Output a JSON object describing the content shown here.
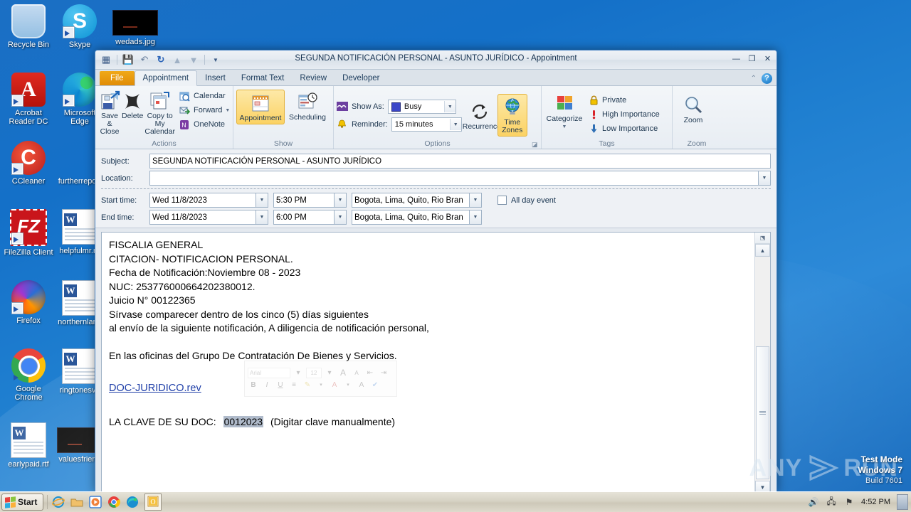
{
  "desktop": {
    "icons": [
      {
        "label": "Recycle Bin",
        "icon": "recycle-bin-icon",
        "shortcut": false
      },
      {
        "label": "Skype",
        "icon": "skype-icon",
        "shortcut": true
      },
      {
        "label": "wedads.jpg",
        "icon": "image-file-icon",
        "shortcut": false
      },
      {
        "label": "Acrobat Reader DC",
        "icon": "acrobat-reader-icon",
        "shortcut": true
      },
      {
        "label": "Microsoft Edge",
        "icon": "microsoft-edge-icon",
        "shortcut": true
      },
      {
        "label": "CCleaner",
        "icon": "ccleaner-icon",
        "shortcut": true
      },
      {
        "label": "furtherreport",
        "icon": "image-file-icon",
        "shortcut": false
      },
      {
        "label": "FileZilla Client",
        "icon": "filezilla-icon",
        "shortcut": true
      },
      {
        "label": "helpfulmr.rtf",
        "icon": "word-document-icon",
        "shortcut": false
      },
      {
        "label": "Firefox",
        "icon": "firefox-icon",
        "shortcut": true
      },
      {
        "label": "northernland",
        "icon": "word-document-icon",
        "shortcut": false
      },
      {
        "label": "Google Chrome",
        "icon": "google-chrome-icon",
        "shortcut": true
      },
      {
        "label": "ringtonesva",
        "icon": "word-document-icon",
        "shortcut": false
      },
      {
        "label": "earlypaid.rtf",
        "icon": "word-document-icon",
        "shortcut": false
      },
      {
        "label": "valuesfriend",
        "icon": "image-file-icon",
        "shortcut": false
      }
    ]
  },
  "window": {
    "title": "SEGUNDA NOTIFICACIÓN PERSONAL - ASUNTO JURÍDICO  -  Appointment",
    "quick_access": [
      "appointment-icon",
      "save-icon",
      "undo-icon",
      "redo-icon",
      "previous-item-icon",
      "next-item-icon",
      "customize-qat-icon"
    ],
    "controls": {
      "minimize": "—",
      "maximize": "❐",
      "close": "✕"
    }
  },
  "tabs": {
    "file": "File",
    "items": [
      {
        "label": "Appointment",
        "active": true
      },
      {
        "label": "Insert",
        "active": false
      },
      {
        "label": "Format Text",
        "active": false
      },
      {
        "label": "Review",
        "active": false
      },
      {
        "label": "Developer",
        "active": false
      }
    ]
  },
  "ribbon": {
    "groups": [
      {
        "name": "Actions",
        "big_buttons": [
          {
            "label": "Save & Close",
            "icon": "save-close-icon",
            "selected": false
          },
          {
            "label": "Delete",
            "icon": "delete-x-icon",
            "selected": false
          },
          {
            "label": "Copy to My Calendar",
            "icon": "copy-calendar-icon",
            "selected": false
          }
        ],
        "small_buttons": [
          {
            "label": "Calendar",
            "icon": "calendar-icon"
          },
          {
            "label": "Forward",
            "icon": "forward-icon",
            "has_arrow": true
          },
          {
            "label": "OneNote",
            "icon": "onenote-icon"
          }
        ]
      },
      {
        "name": "Show",
        "big_buttons": [
          {
            "label": "Appointment",
            "icon": "appointment-icon",
            "selected": true
          },
          {
            "label": "Scheduling",
            "icon": "scheduling-icon",
            "selected": false
          }
        ]
      },
      {
        "name": "Options",
        "show_as_label": "Show As:",
        "show_as_value": "Busy",
        "show_as_icon": "show-as-icon",
        "reminder_label": "Reminder:",
        "reminder_value": "15 minutes",
        "reminder_icon": "bell-icon",
        "recurrence_label": "Recurrence",
        "recurrence_icon": "recurrence-icon",
        "time_zones_label": "Time Zones",
        "time_zones_icon": "globe-icon",
        "time_zones_selected": true
      },
      {
        "name": "Tags",
        "categorize_label": "Categorize",
        "categorize_icon": "categorize-icon",
        "tag_items": [
          {
            "label": "Private",
            "icon": "lock-icon"
          },
          {
            "label": "High Importance",
            "icon": "exclamation-icon"
          },
          {
            "label": "Low Importance",
            "icon": "down-arrow-icon"
          }
        ]
      },
      {
        "name": "Zoom",
        "zoom_label": "Zoom",
        "zoom_icon": "magnifier-icon"
      }
    ]
  },
  "form": {
    "subject_label": "Subject:",
    "subject_value": "SEGUNDA NOTIFICACIÓN PERSONAL - ASUNTO JURÍDICO",
    "location_label": "Location:",
    "location_value": "",
    "start_label": "Start time:",
    "start_date": "Wed 11/8/2023",
    "start_time": "5:30 PM",
    "start_tz": "Bogota, Lima, Quito, Rio Bran",
    "end_label": "End time:",
    "end_date": "Wed 11/8/2023",
    "end_time": "6:00 PM",
    "end_tz": "Bogota, Lima, Quito, Rio Bran",
    "all_day_label": "All day event",
    "all_day_checked": false
  },
  "body": {
    "lines": [
      "FISCALIA GENERAL",
      "CITACION- NOTIFICACION PERSONAL.",
      "Fecha de Notificación:Noviembre 08 - 2023",
      "NUC: 253776000664202380012.",
      "Juicio N° 00122365",
      "Sírvase comparecer dentro de los cinco (5) días siguientes",
      "al envío de la siguiente notificación, A diligencia de notificación personal,"
    ],
    "paragraph2": "En las oficinas del Grupo De Contratación De Bienes y Servicios.",
    "link_text": "DOC-JURIDICO.rev",
    "clave_prefix": "LA CLAVE DE SU DOC:",
    "clave_value": "0012023",
    "clave_suffix": "(Digitar clave manualmente)"
  },
  "mini_toolbar": {
    "font_name": "Arial",
    "font_size": "12",
    "buttons": [
      "grow-font-icon",
      "shrink-font-icon",
      "decrease-indent-icon",
      "increase-indent-icon",
      "bold-icon",
      "italic-icon",
      "underline-icon",
      "align-icon",
      "highlight-icon",
      "font-color-icon",
      "clear-formatting-icon",
      "format-painter-icon"
    ],
    "bold_label": "B",
    "italic_label": "I",
    "underline_label": "U"
  },
  "watermark": {
    "any": "ANY",
    "run": "RUN"
  },
  "test_mode": {
    "line1": "Test Mode",
    "line2": "Windows 7",
    "line3": "Build 7601"
  },
  "taskbar": {
    "start_label": "Start",
    "quick_launch": [
      "internet-explorer-icon",
      "windows-explorer-icon",
      "media-player-icon",
      "google-chrome-icon",
      "microsoft-edge-icon"
    ],
    "running_task": "outlook-appointment-icon",
    "tray_icons": [
      "volume-icon",
      "network-icon",
      "action-center-flag-icon"
    ],
    "clock": "4:52 PM",
    "show_desktop": "show-desktop-button"
  },
  "colors": {
    "accent_orange": "#e08c06",
    "selected_gold": "#fbd264",
    "link_blue": "#1f3fa8",
    "highlight_gray": "#b0bbcb",
    "desktop_blue": "#1470c8"
  }
}
